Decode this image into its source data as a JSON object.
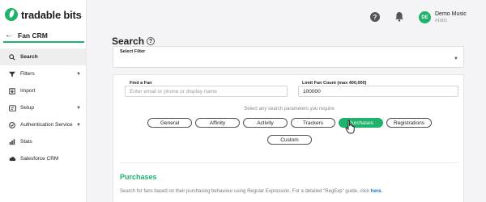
{
  "brand": {
    "name": "tradable bits",
    "color": "#1fb26b"
  },
  "sidebar": {
    "back_label": "Fan CRM",
    "items": [
      {
        "label": "Search",
        "icon": "search-icon",
        "active": true,
        "has_chevron": false
      },
      {
        "label": "Filters",
        "icon": "filter-icon",
        "active": false,
        "has_chevron": true
      },
      {
        "label": "Import",
        "icon": "import-icon",
        "active": false,
        "has_chevron": false
      },
      {
        "label": "Setup",
        "icon": "setup-icon",
        "active": false,
        "has_chevron": true
      },
      {
        "label": "Authentication Service",
        "icon": "check-shield-icon",
        "active": false,
        "has_chevron": true
      },
      {
        "label": "Stats",
        "icon": "bar-chart-icon",
        "active": false,
        "has_chevron": false
      },
      {
        "label": "Salesforce CRM",
        "icon": "cloud-icon",
        "active": false,
        "has_chevron": false
      }
    ]
  },
  "header": {
    "help_icon": "help-circle-icon",
    "bell_icon": "bell-icon",
    "avatar_initials": "DE",
    "user_name": "Demo Music",
    "user_id": "#1001"
  },
  "main": {
    "title": "Search",
    "select_filter": {
      "label": "Select Filter",
      "value": ""
    },
    "find_fan": {
      "label": "Find a Fan",
      "placeholder": "Enter email or phone or display name",
      "value": ""
    },
    "limit": {
      "label": "Limit Fan Count (max 400,000)",
      "value": "100000"
    },
    "hint": "Select any search parameters you require",
    "pills": [
      "General",
      "Affinity",
      "Activity",
      "Trackers",
      "Purchases",
      "Registrations",
      "Custom"
    ],
    "selected_pill": "Purchases",
    "section": {
      "title": "Purchases",
      "description": "Search for fans based on their purchasing behaviour using Regular Expression. For a detailed \"RegExp\" guide, click ",
      "link_text": "here."
    }
  }
}
